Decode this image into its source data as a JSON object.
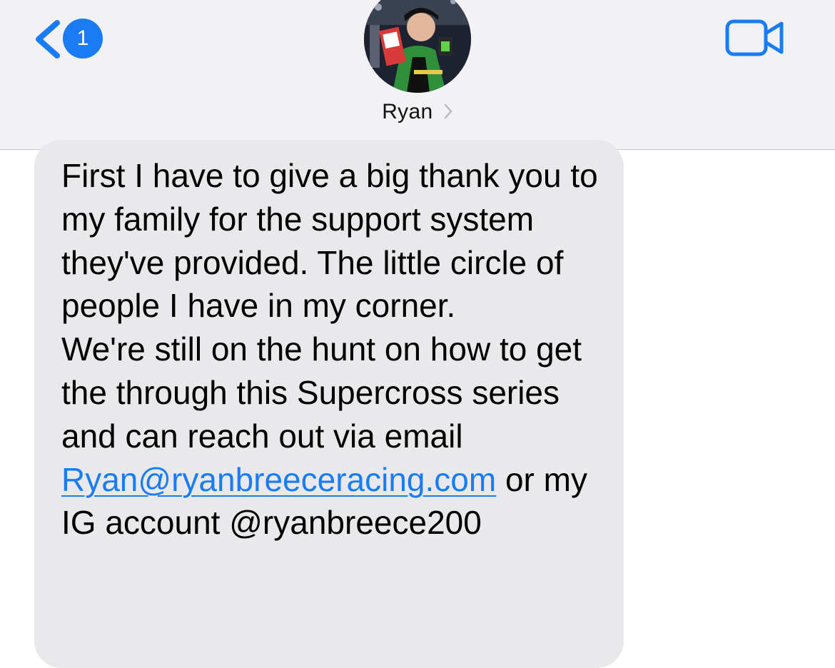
{
  "header": {
    "back_badge_count": "1",
    "contact_name": "Ryan",
    "name_chevron": ">"
  },
  "message": {
    "paragraph1": "First I have to give a big thank you to my family for the support system they've provided. The little circle of people I have in my corner.",
    "paragraph2_before_link": "We're still on the hunt on how to get the through this Supercross series and can reach out via email ",
    "email_link": "Ryan@ryanbreeceracing.com",
    "paragraph2_after_link": " or my IG account @ryanbreece200"
  },
  "colors": {
    "accent": "#1a7cf5",
    "header_bg": "#f2f2f5",
    "bubble_bg": "#e9e9eb"
  },
  "icons": {
    "back": "chevron-left-icon",
    "video": "video-camera-icon"
  }
}
